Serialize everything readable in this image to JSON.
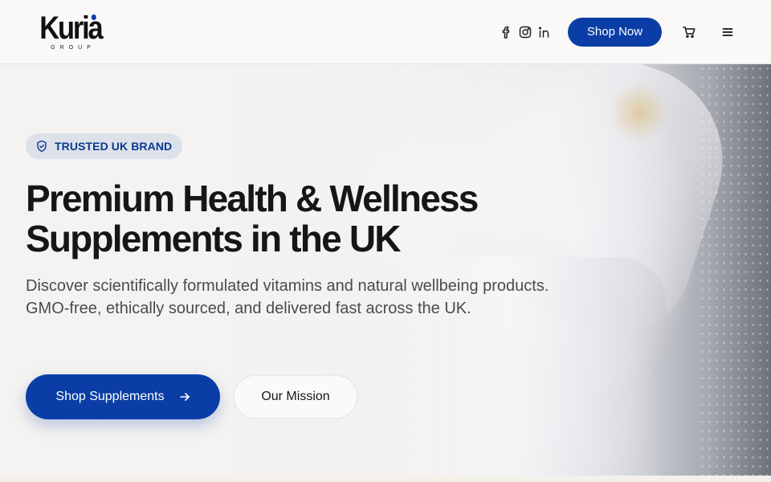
{
  "header": {
    "logo_text": "Kuria",
    "logo_sub": "GROUP",
    "social_icons": [
      "facebook-icon",
      "instagram-icon",
      "linkedin-icon"
    ],
    "shop_now_label": "Shop Now",
    "cart_icon": "cart-icon",
    "menu_icon": "menu-icon"
  },
  "hero": {
    "badge": {
      "icon": "shield-icon",
      "label": "TRUSTED UK BRAND"
    },
    "title_line1": "Premium Health & Wellness",
    "title_line2": "Supplements in the UK",
    "subtitle": "Discover scientifically formulated vitamins and natural wellbeing products. GMO-free, ethically sourced, and delivered fast across the UK.",
    "primary_button": {
      "label": "Shop Supplements",
      "icon": "arrow-right-icon"
    },
    "secondary_button": {
      "label": "Our Mission"
    }
  },
  "colors": {
    "brand_blue": "#0a3ea6",
    "badge_bg": "#dde1ea",
    "text_dark": "#161616",
    "text_muted": "#4b4b4b"
  }
}
